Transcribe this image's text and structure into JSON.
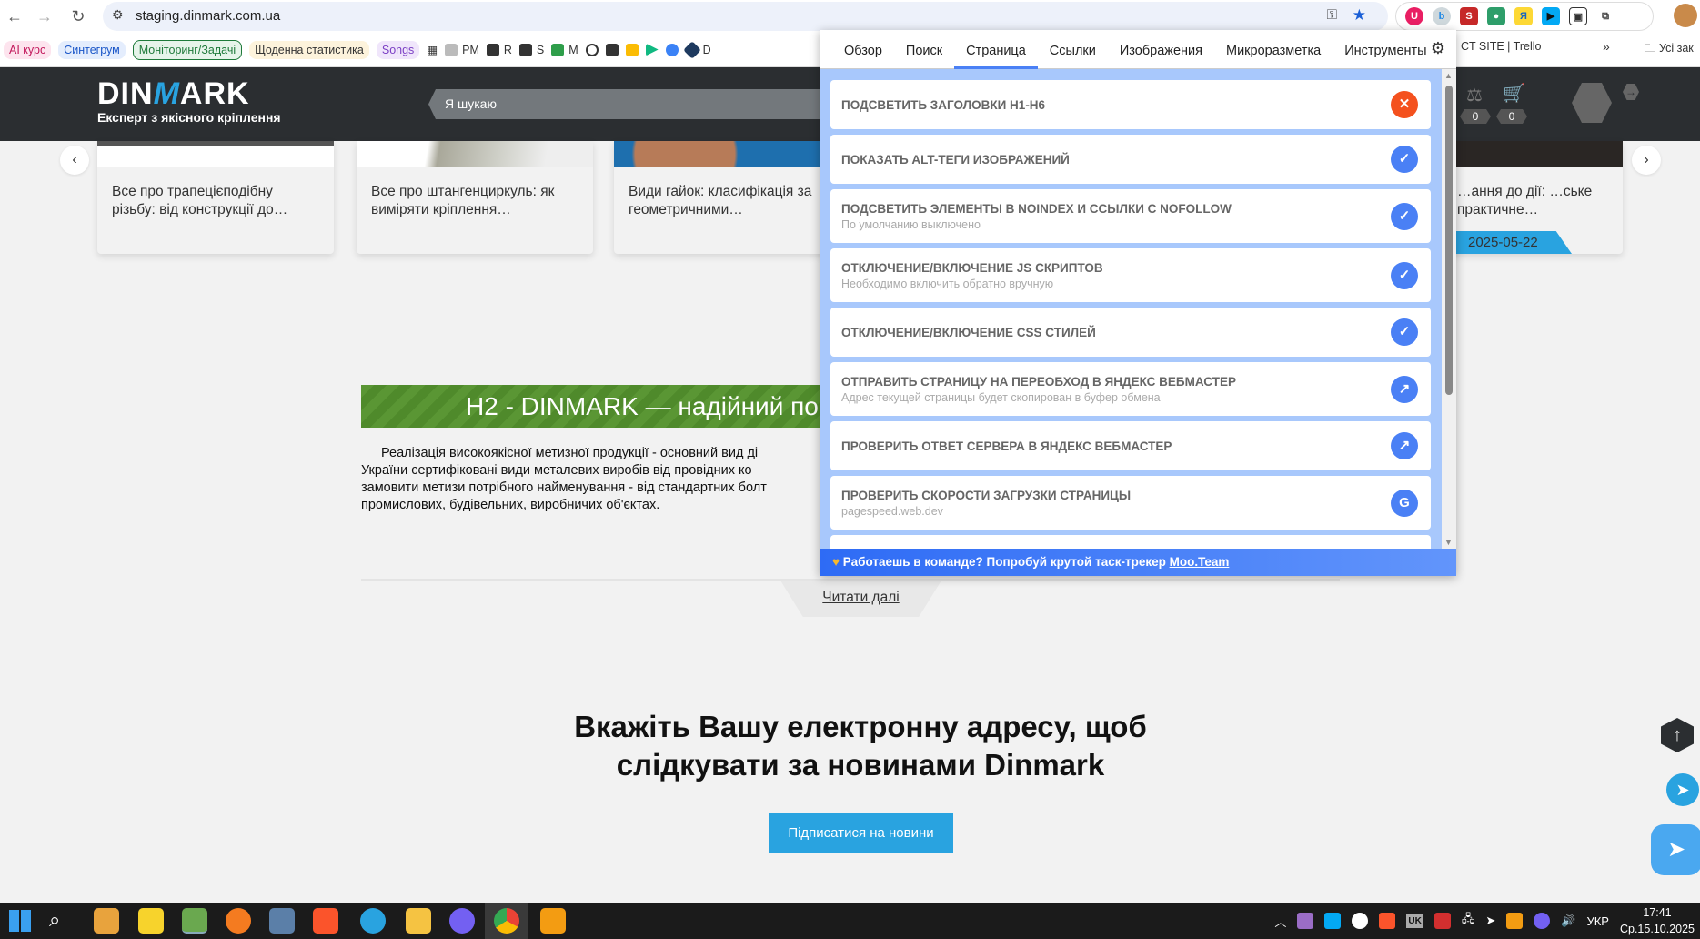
{
  "browser": {
    "url": "staging.dinmark.com.ua"
  },
  "bookmarks": {
    "pills": [
      {
        "label": "AI курс",
        "color": "#c2185b",
        "bg": "#fde4ee"
      },
      {
        "label": "Синтегрум",
        "color": "#1a56c8",
        "bg": "#e4edfd"
      },
      {
        "label": "Моніторинг/Задачі",
        "color": "#1e7a3a",
        "bg": "#e6f4ea"
      },
      {
        "label": "Щоденна статистика",
        "color": "#333",
        "bg": "#fdf3dc"
      },
      {
        "label": "Songs",
        "color": "#7b3fc4",
        "bg": "#f0e6fb"
      }
    ],
    "items": [
      "PM",
      "R",
      "S",
      "M",
      "D"
    ],
    "right": "CT SITE | Trello",
    "more": "»",
    "all": "Усі зак"
  },
  "site": {
    "logo_main": "DIN",
    "logo_accent": "M",
    "logo_rest": "ARK",
    "tagline": "Експерт з якісного кріплення",
    "search_placeholder": "Я шукаю",
    "compare_count": "0",
    "cart_count": "0",
    "cards": [
      "Все про трапецієподібну різьбу: від конструкції до…",
      "Все про штангенциркуль: як виміряти кріплення…",
      "Види гайок: класифікація за геометричними…",
      "…ання до дії: …ське практичне…"
    ],
    "card_date": "2025-05-22",
    "h2": "H2 - DINMARK — надійний по",
    "paragraph": "Реалізація високоякісної метизної продукції - основний вид ді\nУкраїни сертифіковані види металевих виробів від провідних ко\nзамовити метизи потрібного найменування - від стандартних болт\nпромислових, будівельних, виробничих об'єктах.",
    "read_more": "Читати далі",
    "subscribe_heading": "Вкажіть Вашу електронну адресу, щоб слідкувати за новинами Dinmark",
    "subscribe_button": "Підписатися на новини"
  },
  "panel": {
    "tabs": [
      "Обзор",
      "Поиск",
      "Страница",
      "Ссылки",
      "Изображения",
      "Микроразметка",
      "Инструменты"
    ],
    "active_tab": "Страница",
    "items": [
      {
        "title": "Подсветить заголовки H1-H6",
        "sub": "",
        "icon": "close-icon",
        "color": "#f4511e"
      },
      {
        "title": "Показать ALT-теги изображений",
        "sub": "",
        "icon": "check-icon",
        "color": "#4a80f5"
      },
      {
        "title": "Подсветить элементы в noindex и ссылки с nofollow",
        "sub": "По умолчанию выключено",
        "icon": "check-icon",
        "color": "#4a80f5"
      },
      {
        "title": "Отключение/включение JS скриптов",
        "sub": "Необходимо включить обратно вручную",
        "icon": "check-icon",
        "color": "#4a80f5"
      },
      {
        "title": "Отключение/включение CSS стилей",
        "sub": "",
        "icon": "check-icon",
        "color": "#4a80f5"
      },
      {
        "title": "Отправить страницу на переобход в Яндекс Вебмастер",
        "sub": "Адрес текущей страницы будет скопирован в буфер обмена",
        "icon": "external-link-icon",
        "color": "#4a80f5"
      },
      {
        "title": "Проверить ответ сервера в Яндекс Вебмастер",
        "sub": "",
        "icon": "external-link-icon",
        "color": "#4a80f5"
      },
      {
        "title": "Проверить скорости загрузки страницы",
        "sub": "pagespeed.web.dev",
        "icon": "google-icon",
        "color": "#4a80f5"
      }
    ],
    "footer_text": "Работаешь в команде? Попробуй крутой таск-трекер ",
    "footer_link": "Moo.Team"
  },
  "taskbar": {
    "lang": "УКР",
    "time": "17:41",
    "date": "Ср.15.10.2025",
    "tray_uk": "UK"
  }
}
